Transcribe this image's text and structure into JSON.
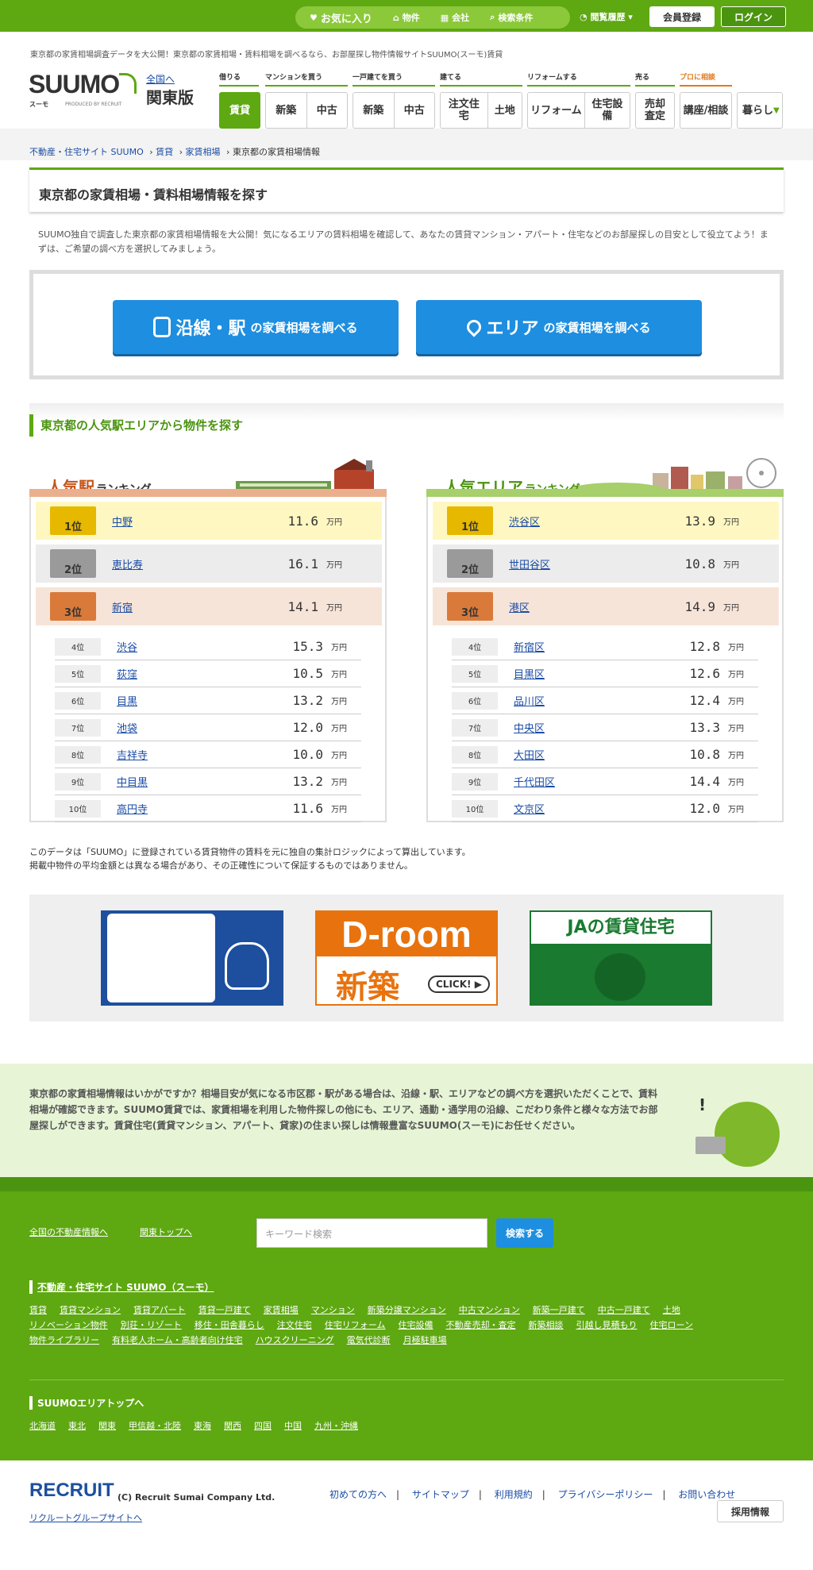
{
  "topnav": {
    "favorites": "お気に入り",
    "properties": "物件",
    "company": "会社",
    "search_cond": "検索条件",
    "history": "閲覧履歴",
    "register": "会員登録",
    "login": "ログイン"
  },
  "header": {
    "desc": "東京都の家賃相場調査データを大公開！東京都の家賃相場・賃料相場を調べるなら、お部屋探し物件情報サイトSUUMO(スーモ)賃貸",
    "logo": "SUUMO",
    "logo_sub": "スーモ",
    "logo_produced": "PRODUCED BY RECRUIT",
    "region_link": "全国へ",
    "region": "関東版"
  },
  "gnav": {
    "cats": [
      "借りる",
      "マンションを買う",
      "一戸建てを買う",
      "建てる",
      "リフォームする",
      "売る",
      "プロに相談"
    ],
    "buttons": [
      "賃貸",
      "新築",
      "中古",
      "新築",
      "中古",
      "注文住宅",
      "土地",
      "リフォーム",
      "住宅設備",
      "売却査定",
      "講座/相談",
      "暮らし"
    ]
  },
  "breadcrumb": {
    "items": [
      "不動産・住宅サイト SUUMO",
      "賃貸",
      "家賃相場"
    ],
    "current": "東京都の家賃相場情報"
  },
  "page": {
    "title": "東京都の家賃相場・賃料相場情報を探す",
    "intro": "SUUMO独自で調査した東京都の家賃相場情報を大公開！気になるエリアの賃料相場を確認して、あなたの賃貸マンション・アパート・住宅などのお部屋探しの目安として役立てよう！まずは、ご希望の調べ方を選択してみましょう。"
  },
  "search": {
    "line_main": "沿線・駅",
    "line_sub": "の家賃相場を調べる",
    "area_main": "エリア",
    "area_sub": "の家賃相場を調べる"
  },
  "popular": {
    "heading": "東京都の人気駅エリアから物件を探す"
  },
  "station_ranking": {
    "title": "人気駅",
    "title_sub": "ランキング",
    "unit": "万円",
    "rows": [
      {
        "rank": "1位",
        "name": "中野",
        "value": "11.6"
      },
      {
        "rank": "2位",
        "name": "恵比寿",
        "value": "16.1"
      },
      {
        "rank": "3位",
        "name": "新宿",
        "value": "14.1"
      },
      {
        "rank": "4位",
        "name": "渋谷",
        "value": "15.3"
      },
      {
        "rank": "5位",
        "name": "荻窪",
        "value": "10.5"
      },
      {
        "rank": "6位",
        "name": "目黒",
        "value": "13.2"
      },
      {
        "rank": "7位",
        "name": "池袋",
        "value": "12.0"
      },
      {
        "rank": "8位",
        "name": "吉祥寺",
        "value": "10.0"
      },
      {
        "rank": "9位",
        "name": "中目黒",
        "value": "13.2"
      },
      {
        "rank": "10位",
        "name": "高円寺",
        "value": "11.6"
      }
    ]
  },
  "area_ranking": {
    "title": "人気エリア",
    "title_sub": "ランキング",
    "unit": "万円",
    "rows": [
      {
        "rank": "1位",
        "name": "渋谷区",
        "value": "13.9"
      },
      {
        "rank": "2位",
        "name": "世田谷区",
        "value": "10.8"
      },
      {
        "rank": "3位",
        "name": "港区",
        "value": "14.9"
      },
      {
        "rank": "4位",
        "name": "新宿区",
        "value": "12.8"
      },
      {
        "rank": "5位",
        "name": "目黒区",
        "value": "12.6"
      },
      {
        "rank": "6位",
        "name": "品川区",
        "value": "12.4"
      },
      {
        "rank": "7位",
        "name": "中央区",
        "value": "13.3"
      },
      {
        "rank": "8位",
        "name": "大田区",
        "value": "10.8"
      },
      {
        "rank": "9位",
        "name": "千代田区",
        "value": "14.4"
      },
      {
        "rank": "10位",
        "name": "文京区",
        "value": "12.0"
      }
    ]
  },
  "note": {
    "line1": "このデータは「SUUMO」に登録されている賃貸物件の賃料を元に独自の集計ロジックによって算出しています。",
    "line2": "掲載中物件の平均金額とは異なる場合があり、その正確性について保証するものではありません。"
  },
  "banners": {
    "droom_top": "D-room",
    "droom_bottom": "新築",
    "droom_click": "CLICK!",
    "ja": "JAの賃貸住宅"
  },
  "info": {
    "text": "東京都の家賃相場情報はいかがですか？相場目安が気になる市区郡・駅がある場合は、沿線・駅、エリアなどの調べ方を選択いただくことで、賃料相場が確認できます。SUUMO賃貸では、家賃相場を利用した物件探しの他にも、エリア、通勤・通学用の沿線、こだわり条件と様々な方法でお部屋探しができます。賃貸住宅(賃貸マンション、アパート、貸家)の住まい探しは情報豊富なSUUMO(スーモ)にお任せください。"
  },
  "footer": {
    "nav": [
      "全国の不動産情報へ",
      "関東トップへ"
    ],
    "search_placeholder": "キーワード検索",
    "search_btn": "検索する",
    "site_heading": "不動産・住宅サイト SUUMO（スーモ）",
    "site_links": [
      "賃貸",
      "賃貸マンション",
      "賃貸アパート",
      "賃貸一戸建て",
      "家賃相場",
      "マンション",
      "新築分譲マンション",
      "中古マンション",
      "新築一戸建て",
      "中古一戸建て",
      "土地",
      "リノベーション物件",
      "別荘・リゾート",
      "移住・田舎暮らし",
      "注文住宅",
      "住宅リフォーム",
      "住宅設備",
      "不動産売却・査定",
      "新築相談",
      "引越し見積もり",
      "住宅ローン",
      "物件ライブラリー",
      "有料老人ホーム・高齢者向け住宅",
      "ハウスクリーニング",
      "電気代診断",
      "月極駐車場"
    ],
    "area_heading": "SUUMOエリアトップへ",
    "area_links": [
      "北海道",
      "東北",
      "関東",
      "甲信越・北陸",
      "東海",
      "関西",
      "四国",
      "中国",
      "九州・沖縄"
    ]
  },
  "bottom": {
    "logo": "RECRUIT",
    "copyright": "(C) Recruit Sumai Company Ltd.",
    "group_link": "リクルートグループサイトへ",
    "links": [
      "初めての方へ",
      "サイトマップ",
      "利用規約",
      "プライバシーポリシー",
      "お問い合わせ"
    ],
    "jobs": "採用情報"
  },
  "colors": {
    "brand_green": "#5ea812",
    "blue_button": "#1e8ee0",
    "gold": "#fff7c2",
    "silver": "#ececec",
    "bronze": "#f7e4d8"
  }
}
